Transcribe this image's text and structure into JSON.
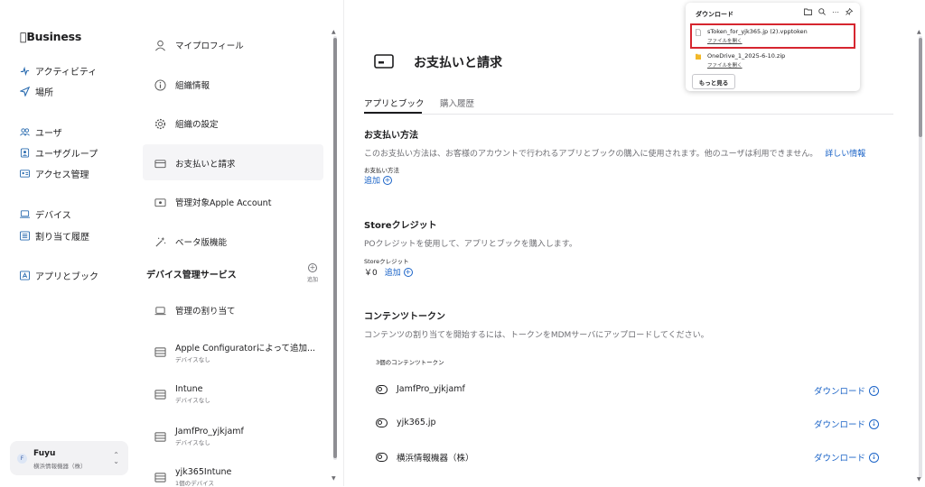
{
  "nav": {
    "brand": "Business",
    "items": [
      {
        "label": "アクティビティ",
        "icon": "activity-icon"
      },
      {
        "label": "場所",
        "icon": "location-arrow-icon"
      },
      {
        "label": "ユーザ",
        "icon": "users-icon"
      },
      {
        "label": "ユーザグループ",
        "icon": "user-group-icon"
      },
      {
        "label": "アクセス管理",
        "icon": "id-card-icon"
      },
      {
        "label": "デバイス",
        "icon": "laptop-icon"
      },
      {
        "label": "割り当て履歴",
        "icon": "list-icon"
      },
      {
        "label": "アプリとブック",
        "icon": "apps-icon"
      }
    ],
    "account": {
      "initial": "F",
      "name": "Fuyu",
      "org": "横浜情報機器（株）"
    }
  },
  "middle": {
    "items": [
      {
        "label": "マイプロフィール",
        "icon": "person-icon"
      },
      {
        "label": "組織情報",
        "icon": "info-icon"
      },
      {
        "label": "組織の設定",
        "icon": "gear-icon"
      },
      {
        "label": "お支払いと請求",
        "icon": "card-icon"
      },
      {
        "label": "管理対象Apple Account",
        "icon": "managed-account-icon"
      },
      {
        "label": "ベータ版機能",
        "icon": "sparkle-icon"
      }
    ],
    "section_title": "デバイス管理サービス",
    "add_label": "追加",
    "services": [
      {
        "label": "管理の割り当て",
        "sub": ""
      },
      {
        "label": "Apple Configuratorによって追加...",
        "sub": "デバイスなし"
      },
      {
        "label": "Intune",
        "sub": "デバイスなし"
      },
      {
        "label": "JamfPro_yjkjamf",
        "sub": "デバイスなし"
      },
      {
        "label": "yjk365Intune",
        "sub": "1個のデバイス"
      }
    ]
  },
  "main": {
    "title": "お支払いと請求",
    "tabs": [
      {
        "label": "アプリとブック",
        "active": true
      },
      {
        "label": "購入履歴",
        "active": false
      }
    ],
    "payment": {
      "heading": "お支払い方法",
      "desc": "このお支払い方法は、お客様のアカウントで行われるアプリとブックの購入に使用されます。他のユーザは利用できません。",
      "more_link": "詳しい情報",
      "label": "お支払い方法",
      "add": "追加"
    },
    "store_credit": {
      "heading": "Storeクレジット",
      "desc": "POクレジットを使用して、アプリとブックを購入します。",
      "label": "Storeクレジット",
      "amount": "￥0",
      "add": "追加"
    },
    "content_tokens": {
      "heading": "コンテンツトークン",
      "desc": "コンテンツの割り当てを開始するには、トークンをMDMサーバにアップロードしてください。",
      "count_label": "3個のコンテンツトークン",
      "download_label": "ダウンロード",
      "rows": [
        {
          "name": "JamfPro_yjkjamf"
        },
        {
          "name": "yjk365.jp"
        },
        {
          "name": "横浜情報機器（株）"
        }
      ]
    }
  },
  "download_popup": {
    "title": "ダウンロード",
    "files": [
      {
        "name": "sToken_for_yjk365.jp (2).vpptoken",
        "action": "ファイルを開く"
      },
      {
        "name": "OneDrive_1_2025-6-10.zip",
        "action": "ファイルを開く"
      }
    ],
    "more_button": "もっと見る",
    "highlight_color": "#d6262f"
  },
  "colors": {
    "accent": "#1a63c7",
    "nav_icon": "#2b6cb0"
  }
}
